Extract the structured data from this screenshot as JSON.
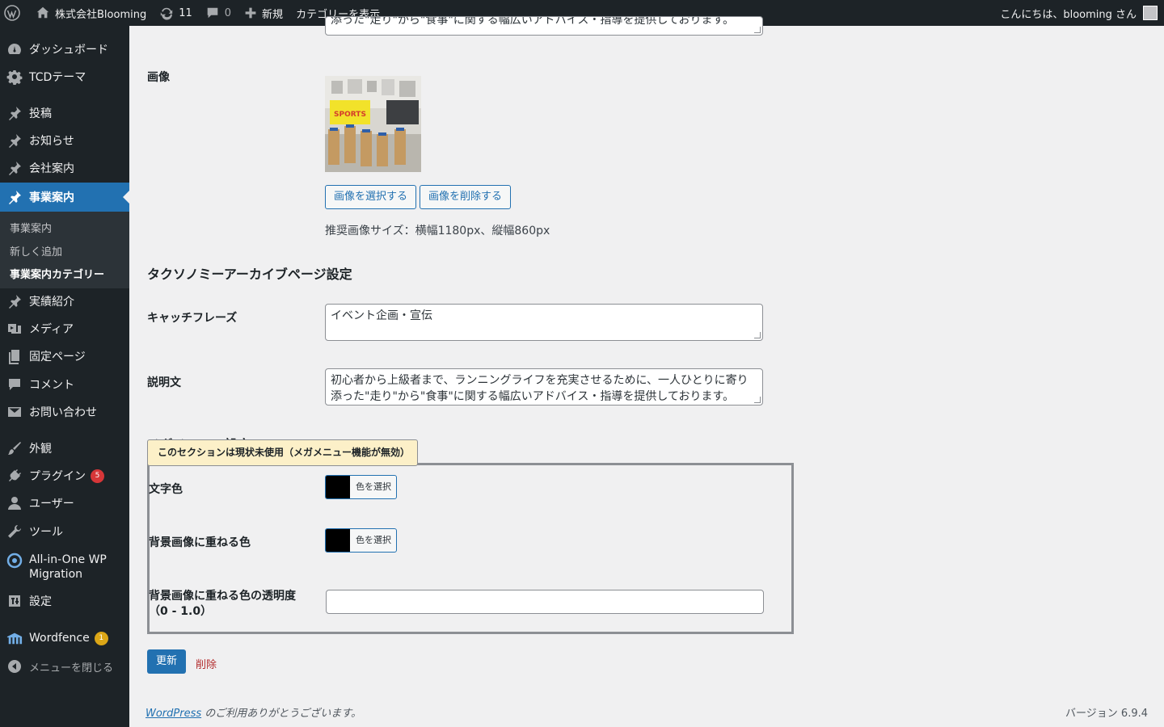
{
  "adminbar": {
    "site_name": "株式会社Blooming",
    "updates_count": "11",
    "comments_count": "0",
    "new_label": "新規",
    "view_category": "カテゴリーを表示",
    "greeting": "こんにちは、blooming さん"
  },
  "sidebar": {
    "items": [
      {
        "label": "ダッシュボード",
        "icon": "dashboard-icon"
      },
      {
        "label": "TCDテーマ",
        "icon": "gear-icon"
      },
      {
        "label": "投稿",
        "icon": "pin-icon"
      },
      {
        "label": "お知らせ",
        "icon": "pin-icon"
      },
      {
        "label": "会社案内",
        "icon": "pin-icon"
      },
      {
        "label": "事業案内",
        "icon": "pin-icon",
        "current": true
      },
      {
        "label": "実績紹介",
        "icon": "pin-icon"
      },
      {
        "label": "メディア",
        "icon": "media-icon"
      },
      {
        "label": "固定ページ",
        "icon": "page-icon"
      },
      {
        "label": "コメント",
        "icon": "comment-icon"
      },
      {
        "label": "お問い合わせ",
        "icon": "mail-icon"
      },
      {
        "label": "外観",
        "icon": "brush-icon"
      },
      {
        "label": "プラグイン",
        "icon": "plugin-icon",
        "badge": "5"
      },
      {
        "label": "ユーザー",
        "icon": "user-icon"
      },
      {
        "label": "ツール",
        "icon": "wrench-icon"
      },
      {
        "label": "All-in-One WP Migration",
        "icon": "migration-icon"
      },
      {
        "label": "設定",
        "icon": "settings-icon"
      },
      {
        "label": "Wordfence",
        "icon": "wordfence-icon",
        "badge": "1"
      }
    ],
    "submenu": [
      "事業案内",
      "新しく追加",
      "事業案内カテゴリー"
    ],
    "collapse_label": "メニューを閉じる"
  },
  "form": {
    "top_textarea_text": "添った\"走り\"から\"食事\"に関する幅広いアドバイス・指導を提供しております。",
    "image_label": "画像",
    "select_image": "画像を選択する",
    "remove_image": "画像を削除する",
    "image_size_note": "推奨画像サイズ：横幅1180px、縦幅860px",
    "taxonomy_title": "タクソノミーアーカイブページ設定",
    "catchphrase_label": "キャッチフレーズ",
    "catchphrase_value": "イベント企画・宣伝",
    "description_label": "説明文",
    "description_value": "初心者から上級者まで、ランニングライフを充実させるために、一人ひとりに寄り添った\"走り\"から\"食事\"に関する幅広いアドバイス・指導を提供しております。",
    "megamenu_title": "メガメニュー設定",
    "tooltip": "このセクションは現状未使用（メガメニュー機能が無効）",
    "text_color_label": "文字色",
    "overlay_color_label": "背景画像に重ねる色",
    "opacity_label_line1": "背景画像に重ねる色の透明度",
    "opacity_label_line2": "（0 - 1.0）",
    "choose_color": "色を選択",
    "text_color_value": "#000000",
    "overlay_color_value": "#000000",
    "update_button": "更新",
    "delete_link": "削除"
  },
  "footer": {
    "wordpress_link": "WordPress",
    "thanks": " のご利用ありがとうございます。",
    "version": "バージョン 6.9.4"
  }
}
